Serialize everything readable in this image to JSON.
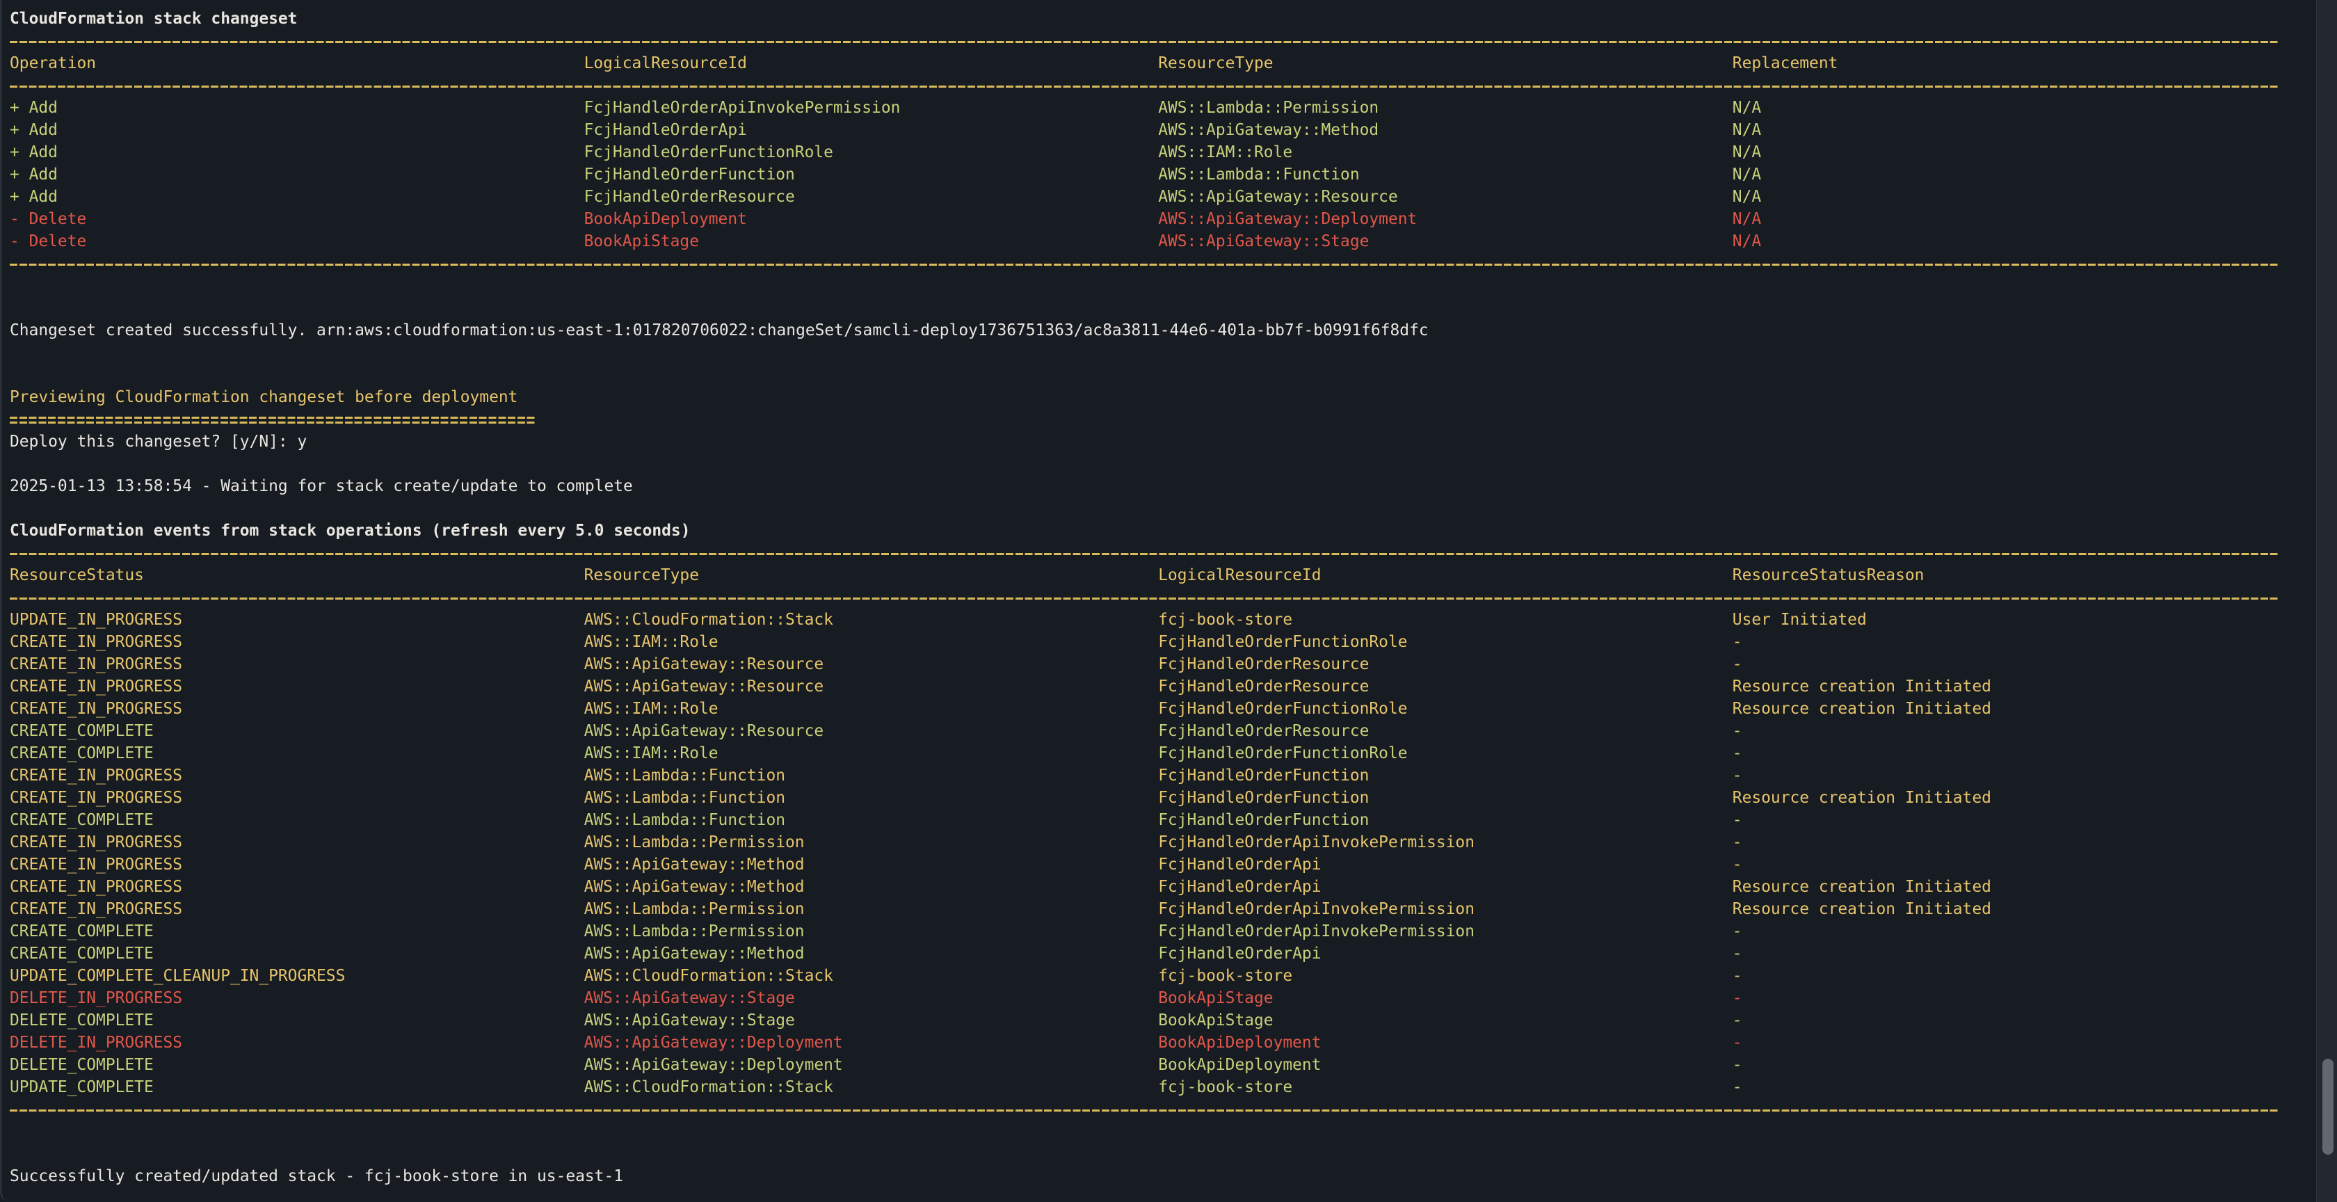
{
  "changeset": {
    "title": "CloudFormation stack changeset",
    "headers": [
      "Operation",
      "LogicalResourceId",
      "ResourceType",
      "Replacement"
    ],
    "rows": [
      {
        "tone": "green",
        "cells": [
          "+ Add",
          "FcjHandleOrderApiInvokePermission",
          "AWS::Lambda::Permission",
          "N/A"
        ]
      },
      {
        "tone": "green",
        "cells": [
          "+ Add",
          "FcjHandleOrderApi",
          "AWS::ApiGateway::Method",
          "N/A"
        ]
      },
      {
        "tone": "green",
        "cells": [
          "+ Add",
          "FcjHandleOrderFunctionRole",
          "AWS::IAM::Role",
          "N/A"
        ]
      },
      {
        "tone": "green",
        "cells": [
          "+ Add",
          "FcjHandleOrderFunction",
          "AWS::Lambda::Function",
          "N/A"
        ]
      },
      {
        "tone": "green",
        "cells": [
          "+ Add",
          "FcjHandleOrderResource",
          "AWS::ApiGateway::Resource",
          "N/A"
        ]
      },
      {
        "tone": "red",
        "cells": [
          "- Delete",
          "BookApiDeployment",
          "AWS::ApiGateway::Deployment",
          "N/A"
        ]
      },
      {
        "tone": "red",
        "cells": [
          "- Delete",
          "BookApiStage",
          "AWS::ApiGateway::Stage",
          "N/A"
        ]
      }
    ]
  },
  "changeset_created": "Changeset created successfully. arn:aws:cloudformation:us-east-1:017820706022:changeSet/samcli-deploy1736751363/ac8a3811-44e6-401a-bb7f-b0991f6f8dfc",
  "preview": {
    "title": "Previewing CloudFormation changeset before deployment",
    "prompt": "Deploy this changeset? [y/N]: y"
  },
  "waiting": "2025-01-13 13:58:54 - Waiting for stack create/update to complete",
  "events": {
    "title": "CloudFormation events from stack operations (refresh every 5.0 seconds)",
    "headers": [
      "ResourceStatus",
      "ResourceType",
      "LogicalResourceId",
      "ResourceStatusReason"
    ],
    "rows": [
      {
        "tone": "yellow",
        "cells": [
          "UPDATE_IN_PROGRESS",
          "AWS::CloudFormation::Stack",
          "fcj-book-store",
          "User Initiated"
        ]
      },
      {
        "tone": "yellow",
        "cells": [
          "CREATE_IN_PROGRESS",
          "AWS::IAM::Role",
          "FcjHandleOrderFunctionRole",
          "-"
        ]
      },
      {
        "tone": "yellow",
        "cells": [
          "CREATE_IN_PROGRESS",
          "AWS::ApiGateway::Resource",
          "FcjHandleOrderResource",
          "-"
        ]
      },
      {
        "tone": "yellow",
        "cells": [
          "CREATE_IN_PROGRESS",
          "AWS::ApiGateway::Resource",
          "FcjHandleOrderResource",
          "Resource creation Initiated"
        ]
      },
      {
        "tone": "yellow",
        "cells": [
          "CREATE_IN_PROGRESS",
          "AWS::IAM::Role",
          "FcjHandleOrderFunctionRole",
          "Resource creation Initiated"
        ]
      },
      {
        "tone": "green",
        "cells": [
          "CREATE_COMPLETE",
          "AWS::ApiGateway::Resource",
          "FcjHandleOrderResource",
          "-"
        ]
      },
      {
        "tone": "green",
        "cells": [
          "CREATE_COMPLETE",
          "AWS::IAM::Role",
          "FcjHandleOrderFunctionRole",
          "-"
        ]
      },
      {
        "tone": "yellow",
        "cells": [
          "CREATE_IN_PROGRESS",
          "AWS::Lambda::Function",
          "FcjHandleOrderFunction",
          "-"
        ]
      },
      {
        "tone": "yellow",
        "cells": [
          "CREATE_IN_PROGRESS",
          "AWS::Lambda::Function",
          "FcjHandleOrderFunction",
          "Resource creation Initiated"
        ]
      },
      {
        "tone": "green",
        "cells": [
          "CREATE_COMPLETE",
          "AWS::Lambda::Function",
          "FcjHandleOrderFunction",
          "-"
        ]
      },
      {
        "tone": "yellow",
        "cells": [
          "CREATE_IN_PROGRESS",
          "AWS::Lambda::Permission",
          "FcjHandleOrderApiInvokePermission",
          "-"
        ]
      },
      {
        "tone": "yellow",
        "cells": [
          "CREATE_IN_PROGRESS",
          "AWS::ApiGateway::Method",
          "FcjHandleOrderApi",
          "-"
        ]
      },
      {
        "tone": "yellow",
        "cells": [
          "CREATE_IN_PROGRESS",
          "AWS::ApiGateway::Method",
          "FcjHandleOrderApi",
          "Resource creation Initiated"
        ]
      },
      {
        "tone": "yellow",
        "cells": [
          "CREATE_IN_PROGRESS",
          "AWS::Lambda::Permission",
          "FcjHandleOrderApiInvokePermission",
          "Resource creation Initiated"
        ]
      },
      {
        "tone": "green",
        "cells": [
          "CREATE_COMPLETE",
          "AWS::Lambda::Permission",
          "FcjHandleOrderApiInvokePermission",
          "-"
        ]
      },
      {
        "tone": "green",
        "cells": [
          "CREATE_COMPLETE",
          "AWS::ApiGateway::Method",
          "FcjHandleOrderApi",
          "-"
        ]
      },
      {
        "tone": "yellow",
        "cells": [
          "UPDATE_COMPLETE_CLEANUP_IN_PROGRESS",
          "AWS::CloudFormation::Stack",
          "fcj-book-store",
          "-"
        ]
      },
      {
        "tone": "red",
        "cells": [
          "DELETE_IN_PROGRESS",
          "AWS::ApiGateway::Stage",
          "BookApiStage",
          "-"
        ]
      },
      {
        "tone": "green",
        "cells": [
          "DELETE_COMPLETE",
          "AWS::ApiGateway::Stage",
          "BookApiStage",
          "-"
        ]
      },
      {
        "tone": "red",
        "cells": [
          "DELETE_IN_PROGRESS",
          "AWS::ApiGateway::Deployment",
          "BookApiDeployment",
          "-"
        ]
      },
      {
        "tone": "green",
        "cells": [
          "DELETE_COMPLETE",
          "AWS::ApiGateway::Deployment",
          "BookApiDeployment",
          "-"
        ]
      },
      {
        "tone": "green",
        "cells": [
          "UPDATE_COMPLETE",
          "AWS::CloudFormation::Stack",
          "fcj-book-store",
          "-"
        ]
      }
    ]
  },
  "final_message": "Successfully created/updated stack - fcj-book-store in us-east-1",
  "scrollbar": {
    "position": 0.96,
    "visible_fraction": 0.08
  },
  "colors": {
    "background": "#171b22",
    "text": "#e8e6df",
    "yellow": "#e5c46b",
    "green": "#c6d17b",
    "red": "#e0574a"
  }
}
